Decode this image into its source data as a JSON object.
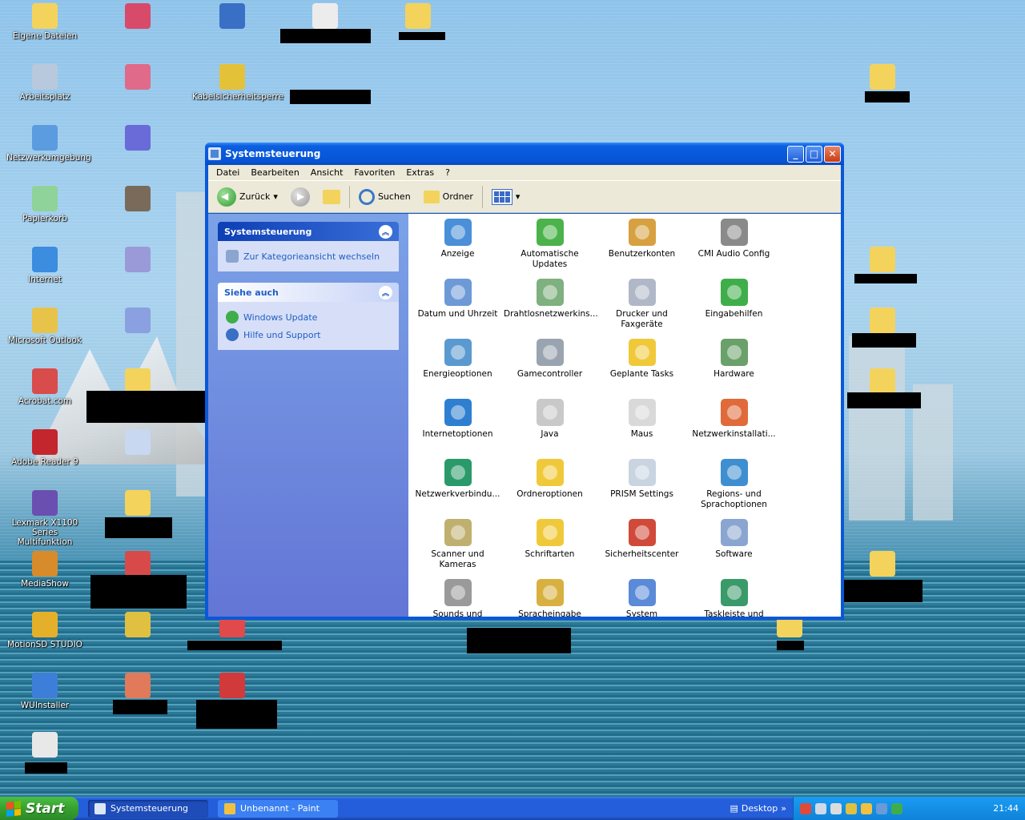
{
  "desktop": {
    "icons": [
      {
        "label": "Eigene Dateien",
        "color": "#f3d35c"
      },
      {
        "label": "Arbeitsplatz",
        "color": "#b8c8dd"
      },
      {
        "label": "Netzwerkumgebung",
        "color": "#5b9be0"
      },
      {
        "label": "Papierkorb",
        "color": "#8fd39a"
      },
      {
        "label": "Internet",
        "color": "#3c8ce0"
      },
      {
        "label": "Microsoft Outlook",
        "color": "#e8c34a"
      },
      {
        "label": "Acrobat.com",
        "color": "#d94c4c"
      },
      {
        "label": "Adobe Reader 9",
        "color": "#c4262e"
      },
      {
        "label": "Lexmark X1100 Series Multifunktion",
        "color": "#6a4fb0"
      },
      {
        "label": "MediaShow",
        "color": "#d78b2a"
      },
      {
        "label": "MotionSD STUDIO",
        "color": "#e4b02a"
      },
      {
        "label": "WUInstaller",
        "color": "#3d7fd8"
      },
      {
        "label": "Kabelsicherheitsperre",
        "color": "#e3c23a"
      }
    ]
  },
  "window": {
    "title": "Systemsteuerung",
    "menu": [
      "Datei",
      "Bearbeiten",
      "Ansicht",
      "Favoriten",
      "Extras",
      "?"
    ],
    "toolbar": {
      "back": "Zurück",
      "search": "Suchen",
      "folders": "Ordner"
    },
    "left_pane": {
      "panel_title": "Systemsteuerung",
      "switch_view": "Zur Kategorieansicht wechseln",
      "see_also_title": "Siehe auch",
      "see_also_links": [
        "Windows Update",
        "Hilfe und Support"
      ]
    },
    "items": [
      {
        "label": "Anzeige",
        "color": "#4a8fd8"
      },
      {
        "label": "Automatische Updates",
        "color": "#4cb24c"
      },
      {
        "label": "Benutzerkonten",
        "color": "#d7a040"
      },
      {
        "label": "CMI Audio Config",
        "color": "#8a8a8a"
      },
      {
        "label": "Datum und Uhrzeit",
        "color": "#6d9ad6"
      },
      {
        "label": "Drahtlosnetzwerkins...",
        "color": "#7fb07f"
      },
      {
        "label": "Drucker und Faxgeräte",
        "color": "#b0b8c8"
      },
      {
        "label": "Eingabehilfen",
        "color": "#3fae4a"
      },
      {
        "label": "Energieoptionen",
        "color": "#5a9ad0"
      },
      {
        "label": "Gamecontroller",
        "color": "#9aa4b0"
      },
      {
        "label": "Geplante Tasks",
        "color": "#f0c93a"
      },
      {
        "label": "Hardware",
        "color": "#6aa06a"
      },
      {
        "label": "Internetoptionen",
        "color": "#2f7fd0"
      },
      {
        "label": "Java",
        "color": "#c9c9c9"
      },
      {
        "label": "Maus",
        "color": "#d9d9d9"
      },
      {
        "label": "Netzwerkinstallati...",
        "color": "#e06a3a"
      },
      {
        "label": "Netzwerkverbindu...",
        "color": "#2a9a6a"
      },
      {
        "label": "Ordneroptionen",
        "color": "#f0c93a"
      },
      {
        "label": "PRISM Settings",
        "color": "#c8d4e0"
      },
      {
        "label": "Regions- und Sprachoptionen",
        "color": "#3f8fd0"
      },
      {
        "label": "Scanner und Kameras",
        "color": "#c0b070"
      },
      {
        "label": "Schriftarten",
        "color": "#f0c93a"
      },
      {
        "label": "Sicherheitscenter",
        "color": "#d04a3a"
      },
      {
        "label": "Software",
        "color": "#8aa6d0"
      },
      {
        "label": "Sounds und",
        "color": "#9a9a9a"
      },
      {
        "label": "Spracheingabe",
        "color": "#d8b040"
      },
      {
        "label": "System",
        "color": "#5a8ad8"
      },
      {
        "label": "Taskleiste und",
        "color": "#3a9a6a"
      }
    ]
  },
  "taskbar": {
    "start_label": "Start",
    "tasks": [
      {
        "label": "Systemsteuerung",
        "active": true
      },
      {
        "label": "Unbenannt - Paint",
        "active": false
      }
    ],
    "desktop_label": "Desktop",
    "clock": "21:44"
  }
}
